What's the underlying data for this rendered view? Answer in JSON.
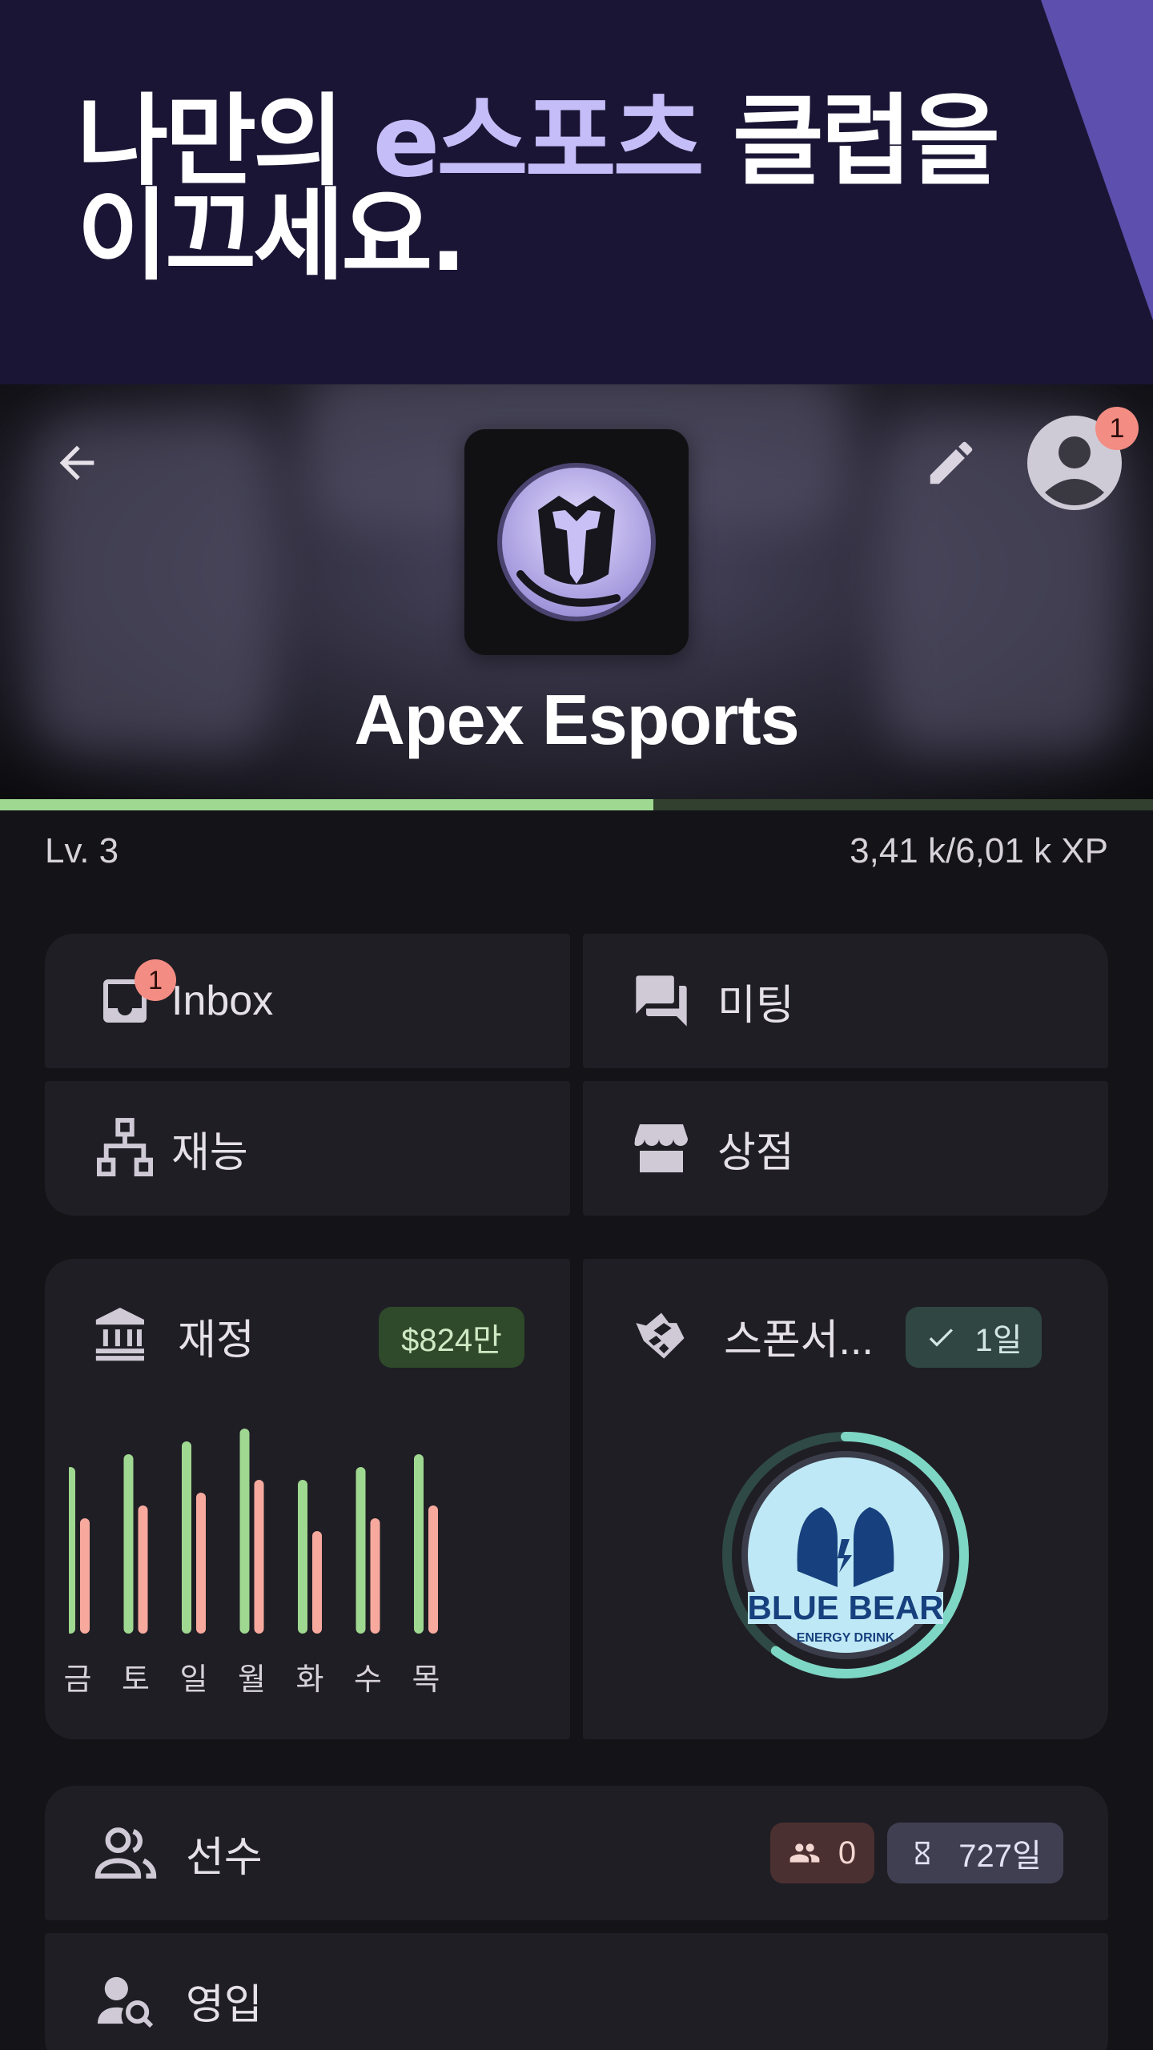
{
  "promo": {
    "title_before": "나만의 ",
    "title_accent": "e스포츠",
    "title_after": " 클럽을",
    "title_line2": "이끄세요."
  },
  "header": {
    "club_name": "Apex Esports",
    "notification_count": "1",
    "icons": {
      "back": "arrow-back-icon",
      "edit": "pencil-icon",
      "profile": "account-circle-icon"
    }
  },
  "progress": {
    "level_label": "Lv.  3",
    "xp_text": "3,41 k/6,01 k XP",
    "xp_fraction": 0.567,
    "colors": {
      "fill": "#9fd891",
      "track": "#31402f"
    }
  },
  "menu": {
    "inbox": {
      "label": "Inbox",
      "badge": "1",
      "icon": "inbox-tray-icon"
    },
    "meetings": {
      "label": "미팅",
      "icon": "chat-bubbles-icon"
    },
    "talents": {
      "label": "재능",
      "icon": "sitemap-icon"
    },
    "shop": {
      "label": "상점",
      "icon": "storefront-icon"
    }
  },
  "finance": {
    "title": "재정",
    "balance_chip": "$824만",
    "icon": "bank-icon",
    "colors": {
      "income": "#9fd891",
      "expense": "#f7a99e",
      "chip_bg": "#2f4a2a",
      "chip_text": "#cfe9c5"
    }
  },
  "chart_data": {
    "type": "bar",
    "categories": [
      "금",
      "토",
      "일",
      "월",
      "화",
      "수",
      "목"
    ],
    "series": [
      {
        "values": [
          130,
          140,
          150,
          160,
          120,
          130,
          140
        ]
      },
      {
        "values": [
          90,
          100,
          110,
          120,
          80,
          90,
          100
        ]
      }
    ],
    "ylim": [
      0,
      170
    ],
    "grid": false,
    "title": "",
    "xlabel": "",
    "ylabel": ""
  },
  "sponsor": {
    "title": "스폰서...",
    "chip_label": "1일",
    "icon": "handshake-icon",
    "chip_icon": "check-icon",
    "badge_text_1": "BLUE BEAR",
    "badge_text_2": "ENERGY DRINK",
    "progress_fraction": 0.6
  },
  "players": {
    "label": "선수",
    "icon": "people-outline-icon",
    "count_chip": "0",
    "days_chip": "727일",
    "count_icon": "group-icon",
    "days_icon": "hourglass-icon"
  },
  "transfers": {
    "label": "영입",
    "icon": "person-search-icon"
  }
}
